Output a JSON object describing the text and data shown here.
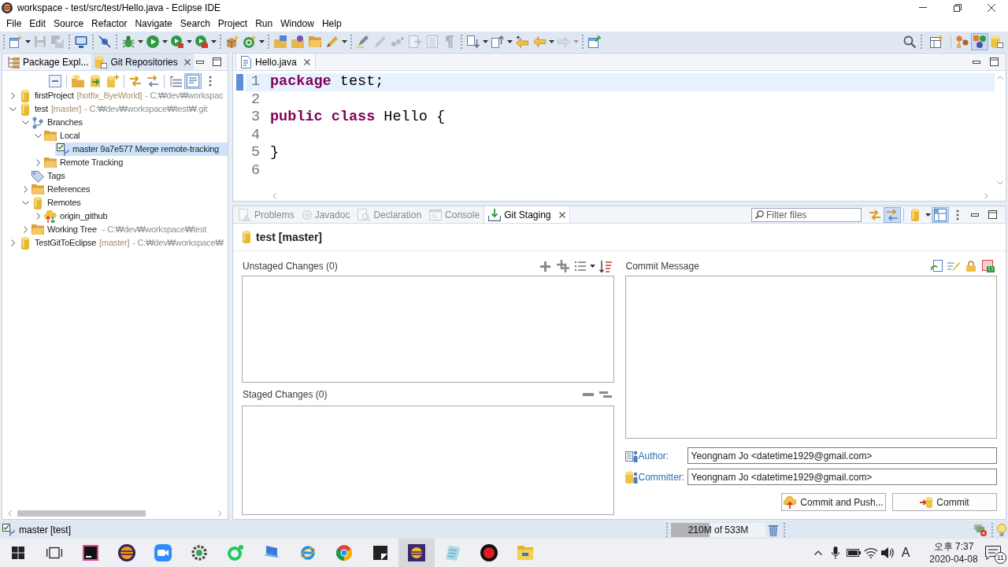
{
  "window": {
    "title": "workspace - test/src/test/Hello.java - Eclipse IDE"
  },
  "menu": [
    "File",
    "Edit",
    "Source",
    "Refactor",
    "Navigate",
    "Search",
    "Project",
    "Run",
    "Window",
    "Help"
  ],
  "toolbar": {
    "groups": [
      [
        {
          "kind": "new",
          "dropdown": true,
          "disabled": false
        },
        {
          "kind": "save",
          "dropdown": false,
          "disabled": true
        },
        {
          "kind": "save_all",
          "dropdown": false,
          "disabled": true
        }
      ],
      [
        {
          "kind": "terminal",
          "dropdown": false,
          "disabled": false
        }
      ],
      [
        {
          "kind": "skip_breakpoints",
          "dropdown": false,
          "disabled": false
        }
      ],
      [
        {
          "kind": "debug",
          "dropdown": true,
          "disabled": false
        },
        {
          "kind": "run",
          "dropdown": true,
          "disabled": false
        },
        {
          "kind": "coverage",
          "dropdown": true,
          "disabled": false
        },
        {
          "kind": "external_tools",
          "dropdown": true,
          "disabled": false
        }
      ],
      [
        {
          "kind": "new_package",
          "dropdown": false,
          "disabled": false
        },
        {
          "kind": "new_class",
          "dropdown": true,
          "disabled": false
        }
      ],
      [
        {
          "kind": "open_type",
          "dropdown": false,
          "disabled": false
        },
        {
          "kind": "open_task",
          "dropdown": false,
          "disabled": false
        },
        {
          "kind": "open_folder",
          "dropdown": false,
          "disabled": false
        },
        {
          "kind": "pen",
          "dropdown": true,
          "disabled": false
        }
      ],
      [
        {
          "kind": "mark_occurrences",
          "dropdown": false,
          "disabled": false
        },
        {
          "kind": "pencil",
          "dropdown": false,
          "disabled": true
        },
        {
          "kind": "dots",
          "dropdown": false,
          "disabled": true
        },
        {
          "kind": "page_arrow",
          "dropdown": false,
          "disabled": true
        },
        {
          "kind": "page_lines",
          "dropdown": false,
          "disabled": true
        },
        {
          "kind": "pilcrow",
          "dropdown": false,
          "disabled": true
        }
      ],
      [
        {
          "kind": "next_annotation",
          "dropdown": true,
          "disabled": false
        },
        {
          "kind": "prev_annotation",
          "dropdown": true,
          "disabled": false
        },
        {
          "kind": "last_edit",
          "dropdown": false,
          "disabled": false
        },
        {
          "kind": "back",
          "dropdown": true,
          "disabled": false
        },
        {
          "kind": "forward",
          "dropdown": true,
          "disabled": true
        }
      ],
      [
        {
          "kind": "pin_window",
          "dropdown": false,
          "disabled": false
        }
      ]
    ],
    "perspectives": [
      {
        "kind": "nodes",
        "selected": false
      },
      {
        "kind": "java",
        "selected": true
      },
      {
        "kind": "git",
        "selected": false
      }
    ]
  },
  "left_panel": {
    "tabs": [
      {
        "label": "Package Expl...",
        "kind": "package_explorer",
        "selected": false
      },
      {
        "label": "Git Repositories",
        "kind": "git_repositories",
        "selected": true
      }
    ],
    "toolbar": [
      [
        {
          "kind": "collapse_all",
          "on": false
        }
      ],
      [
        {
          "kind": "add_repository",
          "on": false
        },
        {
          "kind": "clone",
          "on": false
        },
        {
          "kind": "create_repository",
          "on": false
        }
      ],
      [
        {
          "kind": "refresh",
          "on": false
        },
        {
          "kind": "sync",
          "on": false
        }
      ],
      [
        {
          "kind": "flat",
          "on": false
        },
        {
          "kind": "link",
          "on": true
        }
      ]
    ],
    "tree": [
      {
        "kind": "repo",
        "label": "firstProject",
        "branch": "[hotfix_ByeWorld]",
        "path": "- C:₩dev₩workspac",
        "expanded": false,
        "selected": false
      },
      {
        "kind": "repo",
        "label": "test",
        "branch": "[master]",
        "path": "- C:₩dev₩workspace₩test₩.git",
        "expanded": true,
        "selected": false,
        "children": [
          {
            "kind": "branches",
            "label": "Branches",
            "expanded": true,
            "selected": false,
            "children": [
              {
                "kind": "folder",
                "label": "Local",
                "expanded": true,
                "selected": false,
                "children": [
                  {
                    "kind": "checked_branch",
                    "label": "master 9a7e577 Merge remote-tracking",
                    "selected": true
                  }
                ]
              },
              {
                "kind": "folder",
                "label": "Remote Tracking",
                "expanded": false,
                "selected": false
              }
            ]
          },
          {
            "kind": "tags",
            "label": "Tags",
            "selected": false
          },
          {
            "kind": "folder",
            "label": "References",
            "expanded": false,
            "selected": false
          },
          {
            "kind": "remotes",
            "label": "Remotes",
            "expanded": true,
            "selected": false,
            "children": [
              {
                "kind": "remote",
                "label": "origin_github",
                "expanded": false,
                "selected": false
              }
            ]
          },
          {
            "kind": "folder",
            "label": "Working Tree",
            "path": "- C:₩dev₩workspace₩test",
            "expanded": false,
            "selected": false
          }
        ]
      },
      {
        "kind": "repo",
        "label": "TestGitToEclipse",
        "branch": "[master]",
        "path": "- C:₩dev₩workspace₩",
        "expanded": false,
        "selected": false
      }
    ]
  },
  "editor": {
    "tabs": [
      {
        "label": "Hello.java",
        "selected": true
      }
    ],
    "lines": [
      {
        "number": "1",
        "current": true,
        "tokens": [
          {
            "kind": "keyword",
            "text": "package"
          },
          {
            "kind": "plain",
            "text": " test;"
          }
        ]
      },
      {
        "number": "2",
        "current": false
      },
      {
        "number": "3",
        "current": false,
        "tokens": [
          {
            "kind": "keyword",
            "text": "public"
          },
          {
            "kind": "keyword",
            "text": " class"
          },
          {
            "kind": "plain",
            "text": " Hello {"
          }
        ]
      },
      {
        "number": "4",
        "current": false
      },
      {
        "number": "5",
        "current": false,
        "tokens": [
          {
            "kind": "plain",
            "text": "}"
          }
        ]
      },
      {
        "number": "6",
        "current": false
      }
    ]
  },
  "bottom_panel": {
    "tabs": [
      {
        "label": "Problems",
        "kind": "problems",
        "selected": false
      },
      {
        "label": "Javadoc",
        "kind": "javadoc",
        "selected": false
      },
      {
        "label": "Declaration",
        "kind": "declaration",
        "selected": false
      },
      {
        "label": "Console",
        "kind": "console",
        "selected": false
      },
      {
        "label": "Git Staging",
        "kind": "git_staging",
        "selected": true
      }
    ],
    "filter": {
      "placeholder": "Filter files"
    },
    "toolbar": [
      {
        "kind": "refresh",
        "on": false,
        "dropdown": false
      },
      {
        "kind": "link",
        "on": true,
        "dropdown": false
      },
      {
        "kind": "repository",
        "on": false,
        "dropdown": true
      },
      {
        "kind": "layout",
        "on": true,
        "dropdown": false
      }
    ],
    "staging": {
      "repository": "test [master]",
      "unstaged": {
        "title": "Unstaged Changes (0)"
      },
      "staged": {
        "title": "Staged Changes (0)"
      },
      "commit_message": {
        "title": "Commit Message"
      },
      "author": {
        "label": "Author:",
        "value": "Yeongnam Jo <datetime1929@gmail.com>"
      },
      "committer": {
        "label": "Committer:",
        "value": "Yeongnam Jo <datetime1929@gmail.com>"
      },
      "buttons": [
        {
          "kind": "commit_and_push",
          "label": "Commit and Push..."
        },
        {
          "kind": "commit",
          "label": "Commit"
        }
      ]
    }
  },
  "status_bar": {
    "branch": "master [test]",
    "memory": {
      "reading": "210M of 533M",
      "level": 0.41
    }
  },
  "taskbar": {
    "apps": [
      {
        "kind": "start",
        "selected": false
      },
      {
        "kind": "task_view",
        "selected": false
      },
      {
        "kind": "square_app",
        "selected": false
      },
      {
        "kind": "disc_app",
        "selected": false
      },
      {
        "kind": "camera_app",
        "selected": false
      },
      {
        "kind": "gear_app",
        "selected": false
      },
      {
        "kind": "ring_app",
        "selected": false
      },
      {
        "kind": "laptop_app",
        "selected": false
      },
      {
        "kind": "orbit_app",
        "selected": false
      },
      {
        "kind": "segment_app",
        "selected": false
      },
      {
        "kind": "fold_app",
        "selected": false
      },
      {
        "kind": "tile_app",
        "selected": true
      },
      {
        "kind": "notepad_app",
        "selected": false
      },
      {
        "kind": "record_app",
        "selected": false
      },
      {
        "kind": "folder_app",
        "selected": false
      }
    ],
    "tray": {
      "input_mode": "A",
      "time": "오후 7:37",
      "date": "2020-04-08",
      "notifications": "11"
    }
  }
}
